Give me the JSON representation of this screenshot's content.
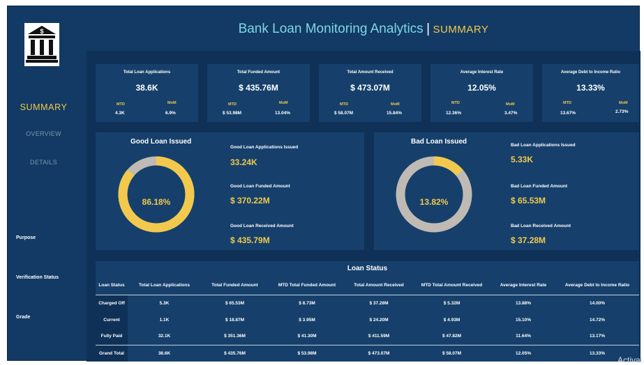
{
  "header": {
    "title": "Bank Loan Monitoring Analytics",
    "separator": "|",
    "subtitle": "SUMMARY"
  },
  "sidebar": {
    "logo_icon": "bank-building-icon",
    "nav": {
      "summary": "SUMMARY",
      "overview": "OVERVIEW",
      "details": "DETAILS"
    },
    "filters": {
      "purpose": "Purpose",
      "verification": "Verification Status",
      "grade": "Grade"
    }
  },
  "kpis": [
    {
      "label": "Total Loan Applications",
      "value": "38.6K",
      "mtd_label": "MTD",
      "mtd": "4.3K",
      "mom_label": "MoM",
      "mom": "6.9%"
    },
    {
      "label": "Total Funded Amount",
      "value": "$ 435.76M",
      "mtd_label": "MTD",
      "mtd": "$ 53.98M",
      "mom_label": "MoM",
      "mom": "13.04%"
    },
    {
      "label": "Total Amount Received",
      "value": "$ 473.07M",
      "mtd_label": "MTD",
      "mtd": "$ 58.07M",
      "mom_label": "MoM",
      "mom": "15.84%"
    },
    {
      "label": "Average Interest Rate",
      "value": "12.05%",
      "mtd_label": "MTD",
      "mtd": "12.36%",
      "mom_label": "MoM",
      "mom": "3.47%"
    },
    {
      "label": "Average Debt to Income Ratio",
      "value": "13.33%",
      "mtd_label": "MTD",
      "mtd": "13.67%",
      "mom_label": "MoM",
      "mom": "2.73%"
    }
  ],
  "good_loan": {
    "title": "Good Loan Issued",
    "percent": "86.18%",
    "fraction": 0.8618,
    "apps_label": "Good Loan Applications Issued",
    "apps": "33.24K",
    "funded_label": "Good Loan Funded Amount",
    "funded": "$ 370.22M",
    "received_label": "Good Loan Received Amount",
    "received": "$ 435.79M"
  },
  "bad_loan": {
    "title": "Bad Loan Issued",
    "percent": "13.82%",
    "fraction": 0.1382,
    "apps_label": "Bad Loan Applications Issued",
    "apps": "5.33K",
    "funded_label": "Bad Loan Funded Amount",
    "funded": "$ 65.53M",
    "received_label": "Bad Loan Received Amount",
    "received": "$ 37.28M"
  },
  "loan_status": {
    "title": "Loan Status",
    "headers": [
      "Loan Status",
      "Total Loan Applications",
      "Total Funded Amount",
      "MTD Total Funded Amount",
      "Total Amount Received",
      "MTD Total Amount Received",
      "Average Interest Rate",
      "Average Debt to Income Ratio"
    ],
    "rows": [
      [
        "Charged Off",
        "5.3K",
        "$ 65.53M",
        "$ 8.73M",
        "$ 37.28M",
        "$ 5.32M",
        "13.88%",
        "14.00%"
      ],
      [
        "Current",
        "1.1K",
        "$ 18.87M",
        "$ 3.95M",
        "$ 24.20M",
        "$ 4.93M",
        "15.10%",
        "14.72%"
      ],
      [
        "Fully Paid",
        "32.1K",
        "$ 351.36M",
        "$ 41.30M",
        "$ 411.59M",
        "$ 47.82M",
        "11.64%",
        "13.17%"
      ],
      [
        "Grand Total",
        "38.6K",
        "$ 435.76M",
        "$ 53.98M",
        "$ 473.07M",
        "$ 58.07M",
        "12.05%",
        "13.33%"
      ]
    ]
  },
  "colors": {
    "accent": "#f2c94c",
    "title": "#7fd6e6",
    "background": "#123a64",
    "panel": "#16406b",
    "ring_grey": "#bfbab3"
  },
  "watermark": "Activat"
}
